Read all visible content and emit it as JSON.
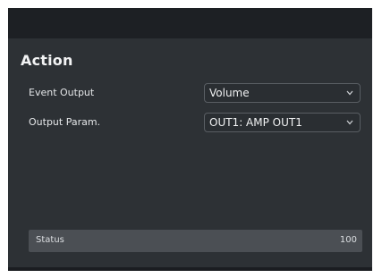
{
  "panel": {
    "title": "Action"
  },
  "rows": [
    {
      "label": "Event Output",
      "value": "Volume"
    },
    {
      "label": "Output Param.",
      "value": "OUT1: AMP OUT1"
    }
  ],
  "status": {
    "label": "Status",
    "value": "100"
  },
  "icons": {
    "dropdown": "chevron-down-icon"
  },
  "colors": {
    "panel_bg": "#2d3135",
    "topbar_bg": "#1d2024",
    "status_bar_bg": "#4b4f54"
  }
}
